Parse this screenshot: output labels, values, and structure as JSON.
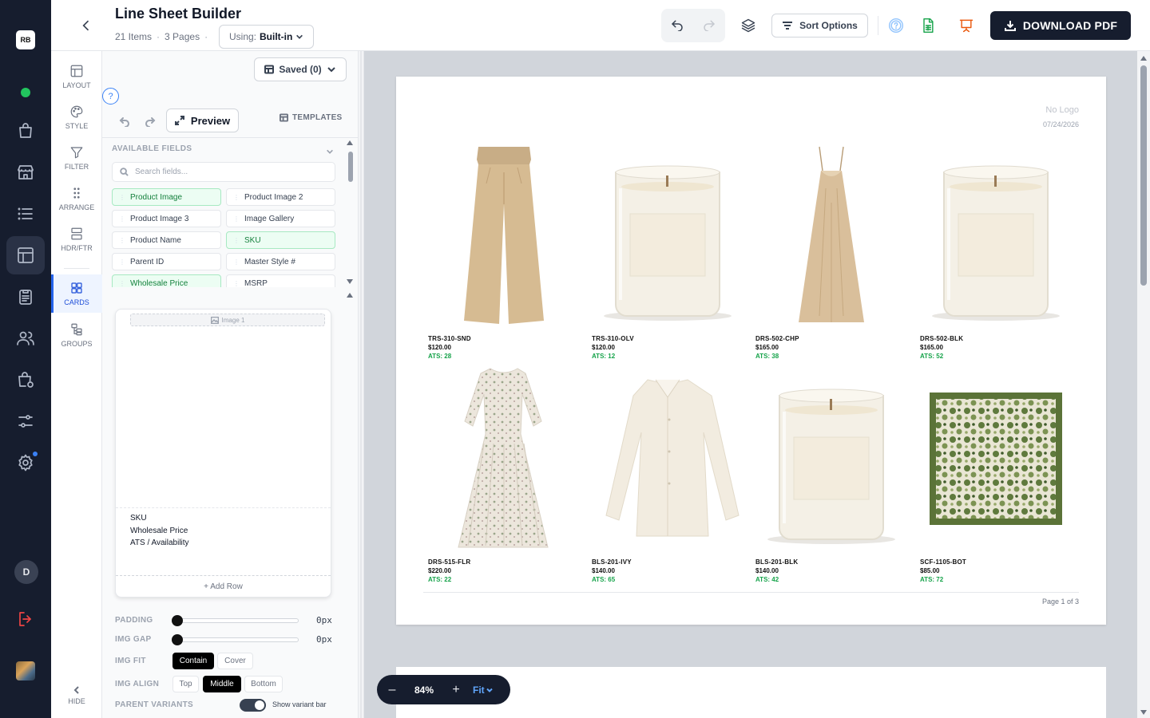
{
  "app": {
    "logo_text": "RB",
    "title": "Line Sheet Builder",
    "item_count": "21 Items",
    "page_count": "3 Pages",
    "using_label": "Using:",
    "using_value": "Built-in"
  },
  "toolbar": {
    "sort_label": "Sort Options",
    "download_label": "DOWNLOAD PDF"
  },
  "rail": {
    "avatar_initial": "D",
    "items": [
      "home-dot",
      "orders-icon",
      "store-icon",
      "list-icon",
      "layout-icon",
      "clipboard-icon",
      "users-icon",
      "bag-settings-icon",
      "sliders-icon",
      "settings-icon"
    ]
  },
  "tools": [
    {
      "label": "LAYOUT",
      "icon": "layout-icon"
    },
    {
      "label": "STYLE",
      "icon": "palette-icon"
    },
    {
      "label": "FILTER",
      "icon": "filter-icon"
    },
    {
      "label": "ARRANGE",
      "icon": "grip-icon"
    },
    {
      "label": "HDR/FTR",
      "icon": "header-footer-icon"
    },
    {
      "label": "CARDS",
      "icon": "grid-icon",
      "active": true
    },
    {
      "label": "GROUPS",
      "icon": "groups-icon"
    }
  ],
  "hide_label": "HIDE",
  "panel": {
    "saved_label": "Saved (0)",
    "preview_label": "Preview",
    "templates_label": "TEMPLATES",
    "available_fields_title": "AVAILABLE FIELDS",
    "search_placeholder": "Search fields...",
    "fields": [
      {
        "label": "Product Image",
        "used": true
      },
      {
        "label": "Product Image 2",
        "used": false
      },
      {
        "label": "Product Image 3",
        "used": false
      },
      {
        "label": "Image Gallery",
        "used": false
      },
      {
        "label": "Product Name",
        "used": false
      },
      {
        "label": "SKU",
        "used": true
      },
      {
        "label": "Parent ID",
        "used": false
      },
      {
        "label": "Master Style #",
        "used": false
      },
      {
        "label": "Wholesale Price",
        "used": true
      },
      {
        "label": "MSRP",
        "used": false
      }
    ],
    "card": {
      "image_slot_label": "Image 1",
      "fields": [
        "SKU",
        "Wholesale Price",
        "ATS / Availability"
      ],
      "add_row_label": "+ Add Row"
    },
    "controls": {
      "padding_label": "PADDING",
      "padding_value": "0px",
      "img_gap_label": "IMG GAP",
      "img_gap_value": "0px",
      "img_fit_label": "IMG FIT",
      "img_fit_options": [
        "Contain",
        "Cover"
      ],
      "img_fit_selected": "Contain",
      "img_align_label": "IMG ALIGN",
      "img_align_options": [
        "Top",
        "Middle",
        "Bottom"
      ],
      "img_align_selected": "Middle",
      "parent_variants_label": "PARENT VARIANTS",
      "show_variant_bar_label": "Show variant bar",
      "show_variant_bar_on": true
    }
  },
  "sheet": {
    "logo_placeholder": "No Logo",
    "date": "07/24/2026",
    "page_label": "Page 1 of 3",
    "products": [
      {
        "sku": "TRS-310-SND",
        "price": "$120.00",
        "ats": "ATS: 28",
        "kind": "pants"
      },
      {
        "sku": "TRS-310-OLV",
        "price": "$120.00",
        "ats": "ATS: 12",
        "kind": "candle"
      },
      {
        "sku": "DRS-502-CHP",
        "price": "$165.00",
        "ats": "ATS: 38",
        "kind": "slipdress"
      },
      {
        "sku": "DRS-502-BLK",
        "price": "$165.00",
        "ats": "ATS: 52",
        "kind": "candle"
      },
      {
        "sku": "DRS-515-FLR",
        "price": "$220.00",
        "ats": "ATS: 22",
        "kind": "floraldress"
      },
      {
        "sku": "BLS-201-IVY",
        "price": "$140.00",
        "ats": "ATS: 65",
        "kind": "blouse"
      },
      {
        "sku": "BLS-201-BLK",
        "price": "$140.00",
        "ats": "ATS: 42",
        "kind": "candle"
      },
      {
        "sku": "SCF-1105-BOT",
        "price": "$85.00",
        "ats": "ATS: 72",
        "kind": "scarf"
      }
    ]
  },
  "zoom": {
    "minus": "–",
    "value": "84%",
    "plus": "+",
    "fit_label": "Fit"
  },
  "colors": {
    "rail_bg": "#161d2e",
    "accent": "#2563eb",
    "ats_green": "#16a34a",
    "used_field_bg": "#ecfdf3"
  }
}
